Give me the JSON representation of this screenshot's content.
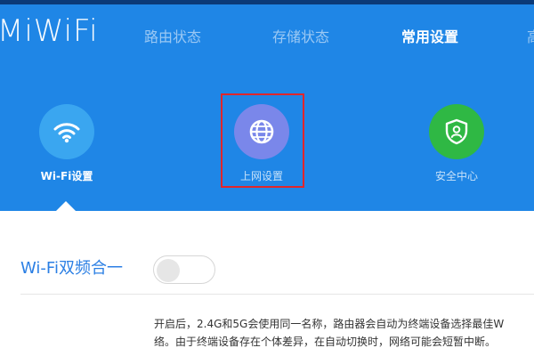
{
  "header": {
    "brand": "MiWiFi",
    "nav": [
      {
        "label": "路由状态"
      },
      {
        "label": "存储状态"
      },
      {
        "label": "常用设置",
        "active": true
      },
      {
        "label": "高"
      }
    ],
    "tiles": [
      {
        "label": "Wi-Fi设置",
        "icon": "wifi-icon",
        "color": "#3aa6f0",
        "active": true
      },
      {
        "label": "上网设置",
        "icon": "globe-icon",
        "color": "#7a87ea"
      },
      {
        "label": "安全中心",
        "icon": "shield-user-icon",
        "color": "#2fb844"
      }
    ]
  },
  "content": {
    "setting_label": "Wi-Fi双频合一",
    "description_line1": "开启后，2.4G和5G会使用同一名称，路由器会自动为终端设备选择最佳W",
    "description_line2": "络。由于终端设备存在个体差异，在自动切换时，网络可能会短暂中断。"
  },
  "colors": {
    "header_bg": "#1f86e6",
    "top_strip": "#0b3a78",
    "accent_text": "#2b7fe4",
    "highlight_border": "#e1262b"
  }
}
